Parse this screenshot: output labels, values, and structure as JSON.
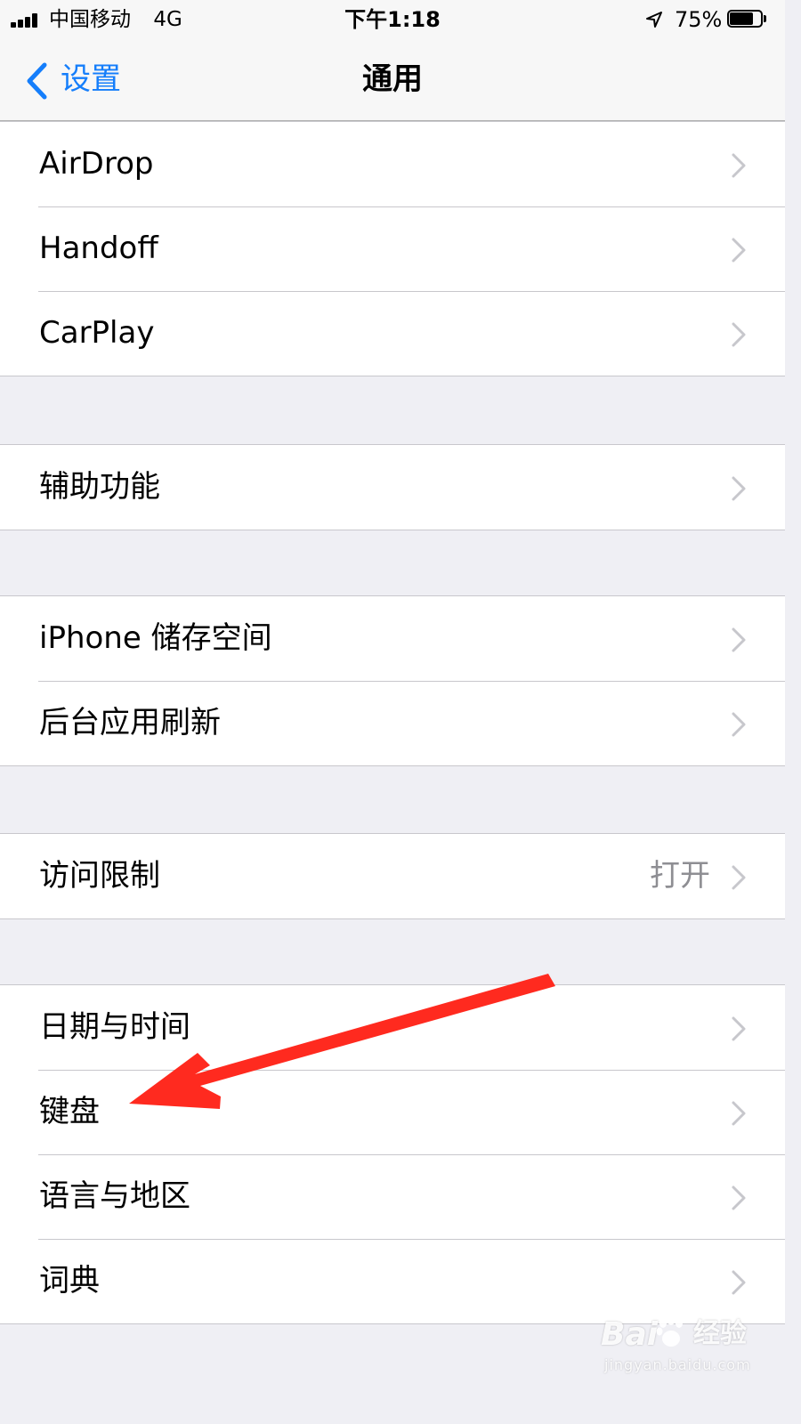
{
  "status_bar": {
    "carrier": "中国移动",
    "network": "4G",
    "time": "下午1:18",
    "battery_percent": "75%",
    "battery_level": 0.75,
    "icons": [
      "signal-bars-icon",
      "location-arrow-icon",
      "battery-icon"
    ]
  },
  "nav": {
    "back_label": "设置",
    "title": "通用",
    "accent_color": "#157efb"
  },
  "groups": [
    {
      "items": [
        {
          "label": "AirDrop"
        },
        {
          "label": "Handoff"
        },
        {
          "label": "CarPlay"
        }
      ]
    },
    {
      "items": [
        {
          "label": "辅助功能"
        }
      ]
    },
    {
      "items": [
        {
          "label": "iPhone 储存空间"
        },
        {
          "label": "后台应用刷新"
        }
      ]
    },
    {
      "items": [
        {
          "label": "访问限制",
          "value": "打开"
        }
      ]
    },
    {
      "items": [
        {
          "label": "日期与时间"
        },
        {
          "label": "键盘"
        },
        {
          "label": "语言与地区"
        },
        {
          "label": "词典"
        }
      ]
    }
  ],
  "annotation": {
    "color": "#ff2a1f",
    "points_to": "键盘"
  },
  "watermark": {
    "brand_left": "Bai",
    "brand_right": "经验",
    "url": "jingyan.baidu.com"
  },
  "colors": {
    "background": "#efeff4",
    "cell_background": "#ffffff",
    "separator": "#c8c7cc",
    "chevron": "#c7c7cc",
    "secondary_text": "#8e8e93"
  }
}
